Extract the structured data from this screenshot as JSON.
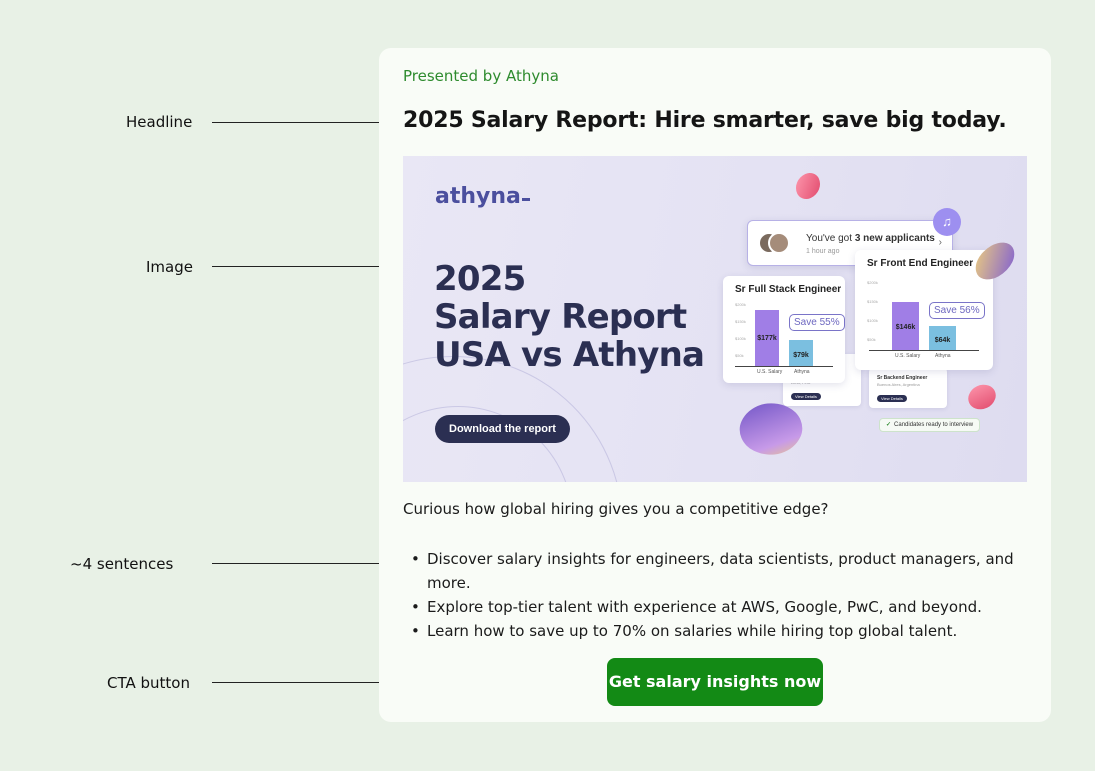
{
  "annotations": {
    "headline": "Headline",
    "image": "Image",
    "sentences": "~4 sentences",
    "cta": "CTA button"
  },
  "ad": {
    "presented_by": "Presented by Athyna",
    "headline": "2025 Salary Report: Hire smarter, save big today.",
    "intro": "Curious how global hiring gives you a competitive edge?",
    "bullets": [
      "Discover salary insights for engineers, data scientists, product managers, and more.",
      "Explore top-tier talent with experience at AWS, Google, PwC, and beyond.",
      "Learn how to save up to 70% on salaries while hiring top global talent."
    ],
    "cta_label": "Get salary insights now"
  },
  "hero": {
    "logo": "athyna",
    "title_line1": "2025",
    "title_line2": "Salary Report",
    "title_line3": "USA vs Athyna",
    "button": "Download the report",
    "notification": {
      "text_prefix": "You've got ",
      "text_bold": "3 new applicants",
      "time": "1 hour ago"
    },
    "card_left": {
      "title": "Sr Full Stack Engineer",
      "us_value": "$177k",
      "athyna_value": "$79k",
      "save": "Save 55%",
      "us_label": "U.S. Salary",
      "athyna_label": "Athyna",
      "ticks": [
        "$200k",
        "$150k",
        "$100k",
        "$50k"
      ]
    },
    "card_right": {
      "title": "Sr Front End Engineer",
      "us_value": "$146k",
      "athyna_value": "$64k",
      "save": "Save 56%",
      "us_label": "U.S. Salary",
      "athyna_label": "Athyna",
      "ticks": [
        "$200k",
        "$150k",
        "$100k",
        "$50k"
      ]
    },
    "ghost_left": {
      "subtitle": "Lima, Peru",
      "button": "View Details"
    },
    "ghost_right": {
      "title": "Sr Backend Engineer",
      "subtitle": "Buenos Aires, Argentina",
      "button": "View Details"
    },
    "ready_badge": "Candidates ready to interview"
  },
  "colors": {
    "page_bg": "#e8f1e6",
    "brand_green": "#138a15",
    "presented_green": "#2e8b2e",
    "navy": "#2b2f52",
    "bar_purple": "#a07ee6",
    "bar_blue": "#7bbfe0"
  }
}
